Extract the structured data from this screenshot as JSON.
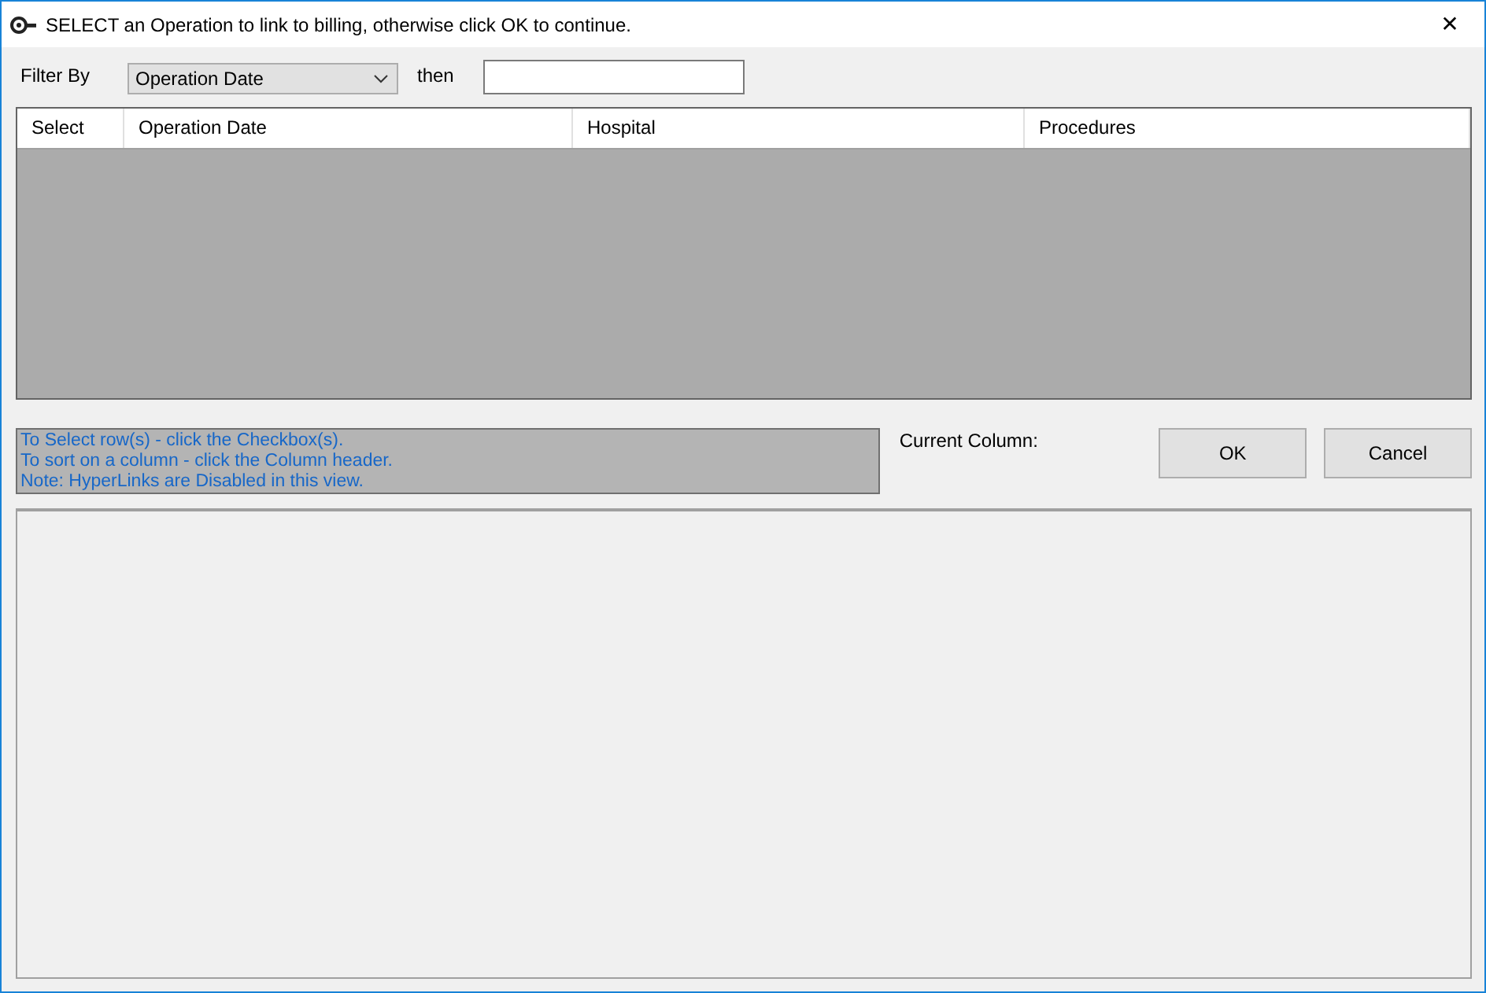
{
  "window": {
    "title": "SELECT an Operation to link to billing, otherwise click OK to continue.",
    "close": "✕"
  },
  "filter": {
    "label": "Filter By",
    "value": "Operation Date",
    "then_label": "then"
  },
  "table": {
    "columns": [
      "Select",
      "Operation Date",
      "Hospital",
      "Procedures"
    ]
  },
  "info": [
    "To Select row(s) - click the Checkbox(s).",
    "To sort on a column - click the Column header.",
    "Note: HyperLinks are Disabled in this view."
  ],
  "current_column": {
    "label": "Current Column:"
  },
  "buttons": [
    "OK",
    "Cancel"
  ]
}
